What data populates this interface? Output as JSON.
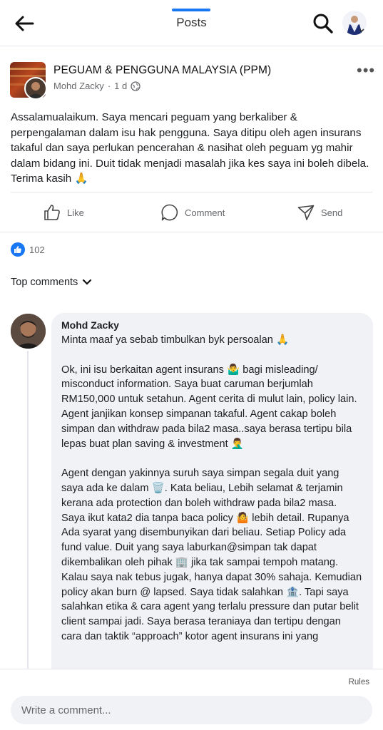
{
  "header": {
    "title": "Posts",
    "accent_color": "#1877f2"
  },
  "post": {
    "group_name": "PEGUAM & PENGGUNA MALAYSIA (PPM)",
    "author": "Mohd Zacky",
    "time": "1 d",
    "separator": "·",
    "privacy_icon": "globe-icon",
    "body": "Assalamualaikum. Saya mencari peguam yang berkaliber & perpengalaman dalam isu hak pengguna. Saya ditipu oleh agen insurans takaful dan saya perlukan pencerahan & nasihat oleh peguam yg mahir dalam bidang ini. Duit tidak menjadi masalah jika kes saya ini boleh dibela. Terima kasih 🙏",
    "actions": {
      "like": "Like",
      "comment": "Comment",
      "send": "Send"
    },
    "reaction_count": "102"
  },
  "comments": {
    "filter_label": "Top comments",
    "items": [
      {
        "author": "Mohd Zacky",
        "text": "Minta maaf ya sebab timbulkan byk persoalan 🙏\n\nOk, ini isu berkaitan agent insurans 🤷‍♂️ bagi misleading/ misconduct information. Saya buat caruman berjumlah RM150,000 untuk setahun. Agent cerita di mulut lain, policy lain. Agent janjikan konsep simpanan takaful. Agent cakap boleh simpan dan withdraw pada bila2 masa..saya berasa tertipu bila lepas buat plan saving & investment 🤦‍♂️\n\nAgent dengan yakinnya suruh saya simpan segala duit yang saya ada ke dalam 🗑️. Kata beliau, Lebih selamat & terjamin kerana ada protection dan boleh withdraw pada bila2 masa. Saya ikut kata2 dia tanpa baca policy 🤷 lebih detail. Rupanya Ada syarat yang disembunyikan dari beliau. Setiap Policy ada fund value. Duit yang saya laburkan@simpan tak dapat dikembalikan oleh pihak 🏢 jika tak sampai tempoh matang. Kalau saya nak tebus jugak, hanya dapat 30% sahaja. Kemudian policy akan burn @ lapsed. Saya tidak salahkan 🏦. Tapi saya salahkan etika & cara agent yang terlalu pressure dan putar belit client sampai jadi. Saya berasa teraniaya dan tertipu dengan cara dan taktik “approach” kotor agent insurans ini yang"
      }
    ]
  },
  "composer": {
    "rules_label": "Rules",
    "placeholder": "Write a comment..."
  }
}
